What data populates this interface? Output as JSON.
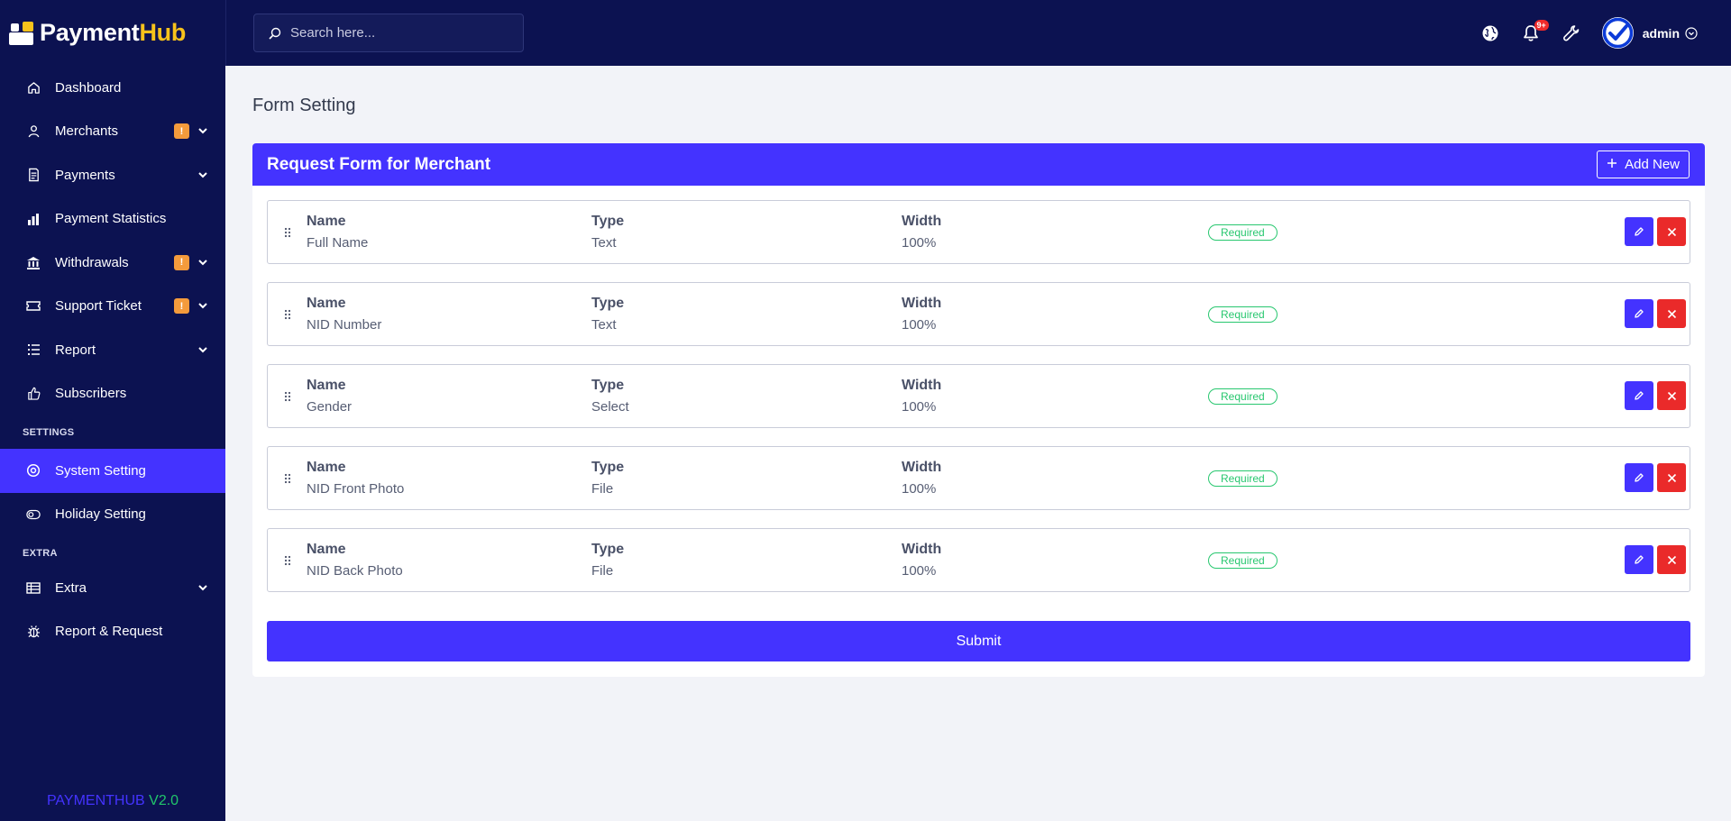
{
  "brand": {
    "name_part1": "Payment",
    "name_part2": "Hub",
    "accent": "#f7c21b"
  },
  "sidebar": {
    "items": [
      {
        "label": "Dashboard",
        "icon": "home-icon"
      },
      {
        "label": "Merchants",
        "icon": "user-icon",
        "badge": "!"
      },
      {
        "label": "Payments",
        "icon": "receipt-icon"
      },
      {
        "label": "Payment Statistics",
        "icon": "bar-chart-icon"
      },
      {
        "label": "Withdrawals",
        "icon": "bank-icon",
        "badge": "!"
      },
      {
        "label": "Support Ticket",
        "icon": "ticket-icon",
        "badge": "!"
      },
      {
        "label": "Report",
        "icon": "list-icon"
      },
      {
        "label": "Subscribers",
        "icon": "thumbs-up-icon"
      }
    ],
    "section_settings": "SETTINGS",
    "settings_items": [
      {
        "label": "System Setting",
        "icon": "settings-icon"
      },
      {
        "label": "Holiday Setting",
        "icon": "toggle-icon"
      }
    ],
    "section_extra": "EXTRA",
    "extra_items": [
      {
        "label": "Extra",
        "icon": "table-icon"
      },
      {
        "label": "Report & Request",
        "icon": "bug-icon"
      }
    ],
    "version_name": "PAYMENTHUB",
    "version_number": "V2.0"
  },
  "topbar": {
    "search_placeholder": "Search here...",
    "notification_count": "9+",
    "username": "admin"
  },
  "page": {
    "title": "Form Setting",
    "card_title": "Request Form for Merchant",
    "add_button": "Add New",
    "submit_button": "Submit",
    "col_name": "Name",
    "col_type": "Type",
    "col_width": "Width",
    "fields": [
      {
        "name": "Full Name",
        "type": "Text",
        "width": "100%",
        "status": "Required"
      },
      {
        "name": "NID Number",
        "type": "Text",
        "width": "100%",
        "status": "Required"
      },
      {
        "name": "Gender",
        "type": "Select",
        "width": "100%",
        "status": "Required"
      },
      {
        "name": "NID Front Photo",
        "type": "File",
        "width": "100%",
        "status": "Required"
      },
      {
        "name": "NID Back Photo",
        "type": "File",
        "width": "100%",
        "status": "Required"
      }
    ]
  },
  "colors": {
    "sidebar_bg": "#0c1251",
    "primary": "#4433ff",
    "danger": "#ea2a2a",
    "success": "#28c76f",
    "warning": "#f49b3c"
  }
}
